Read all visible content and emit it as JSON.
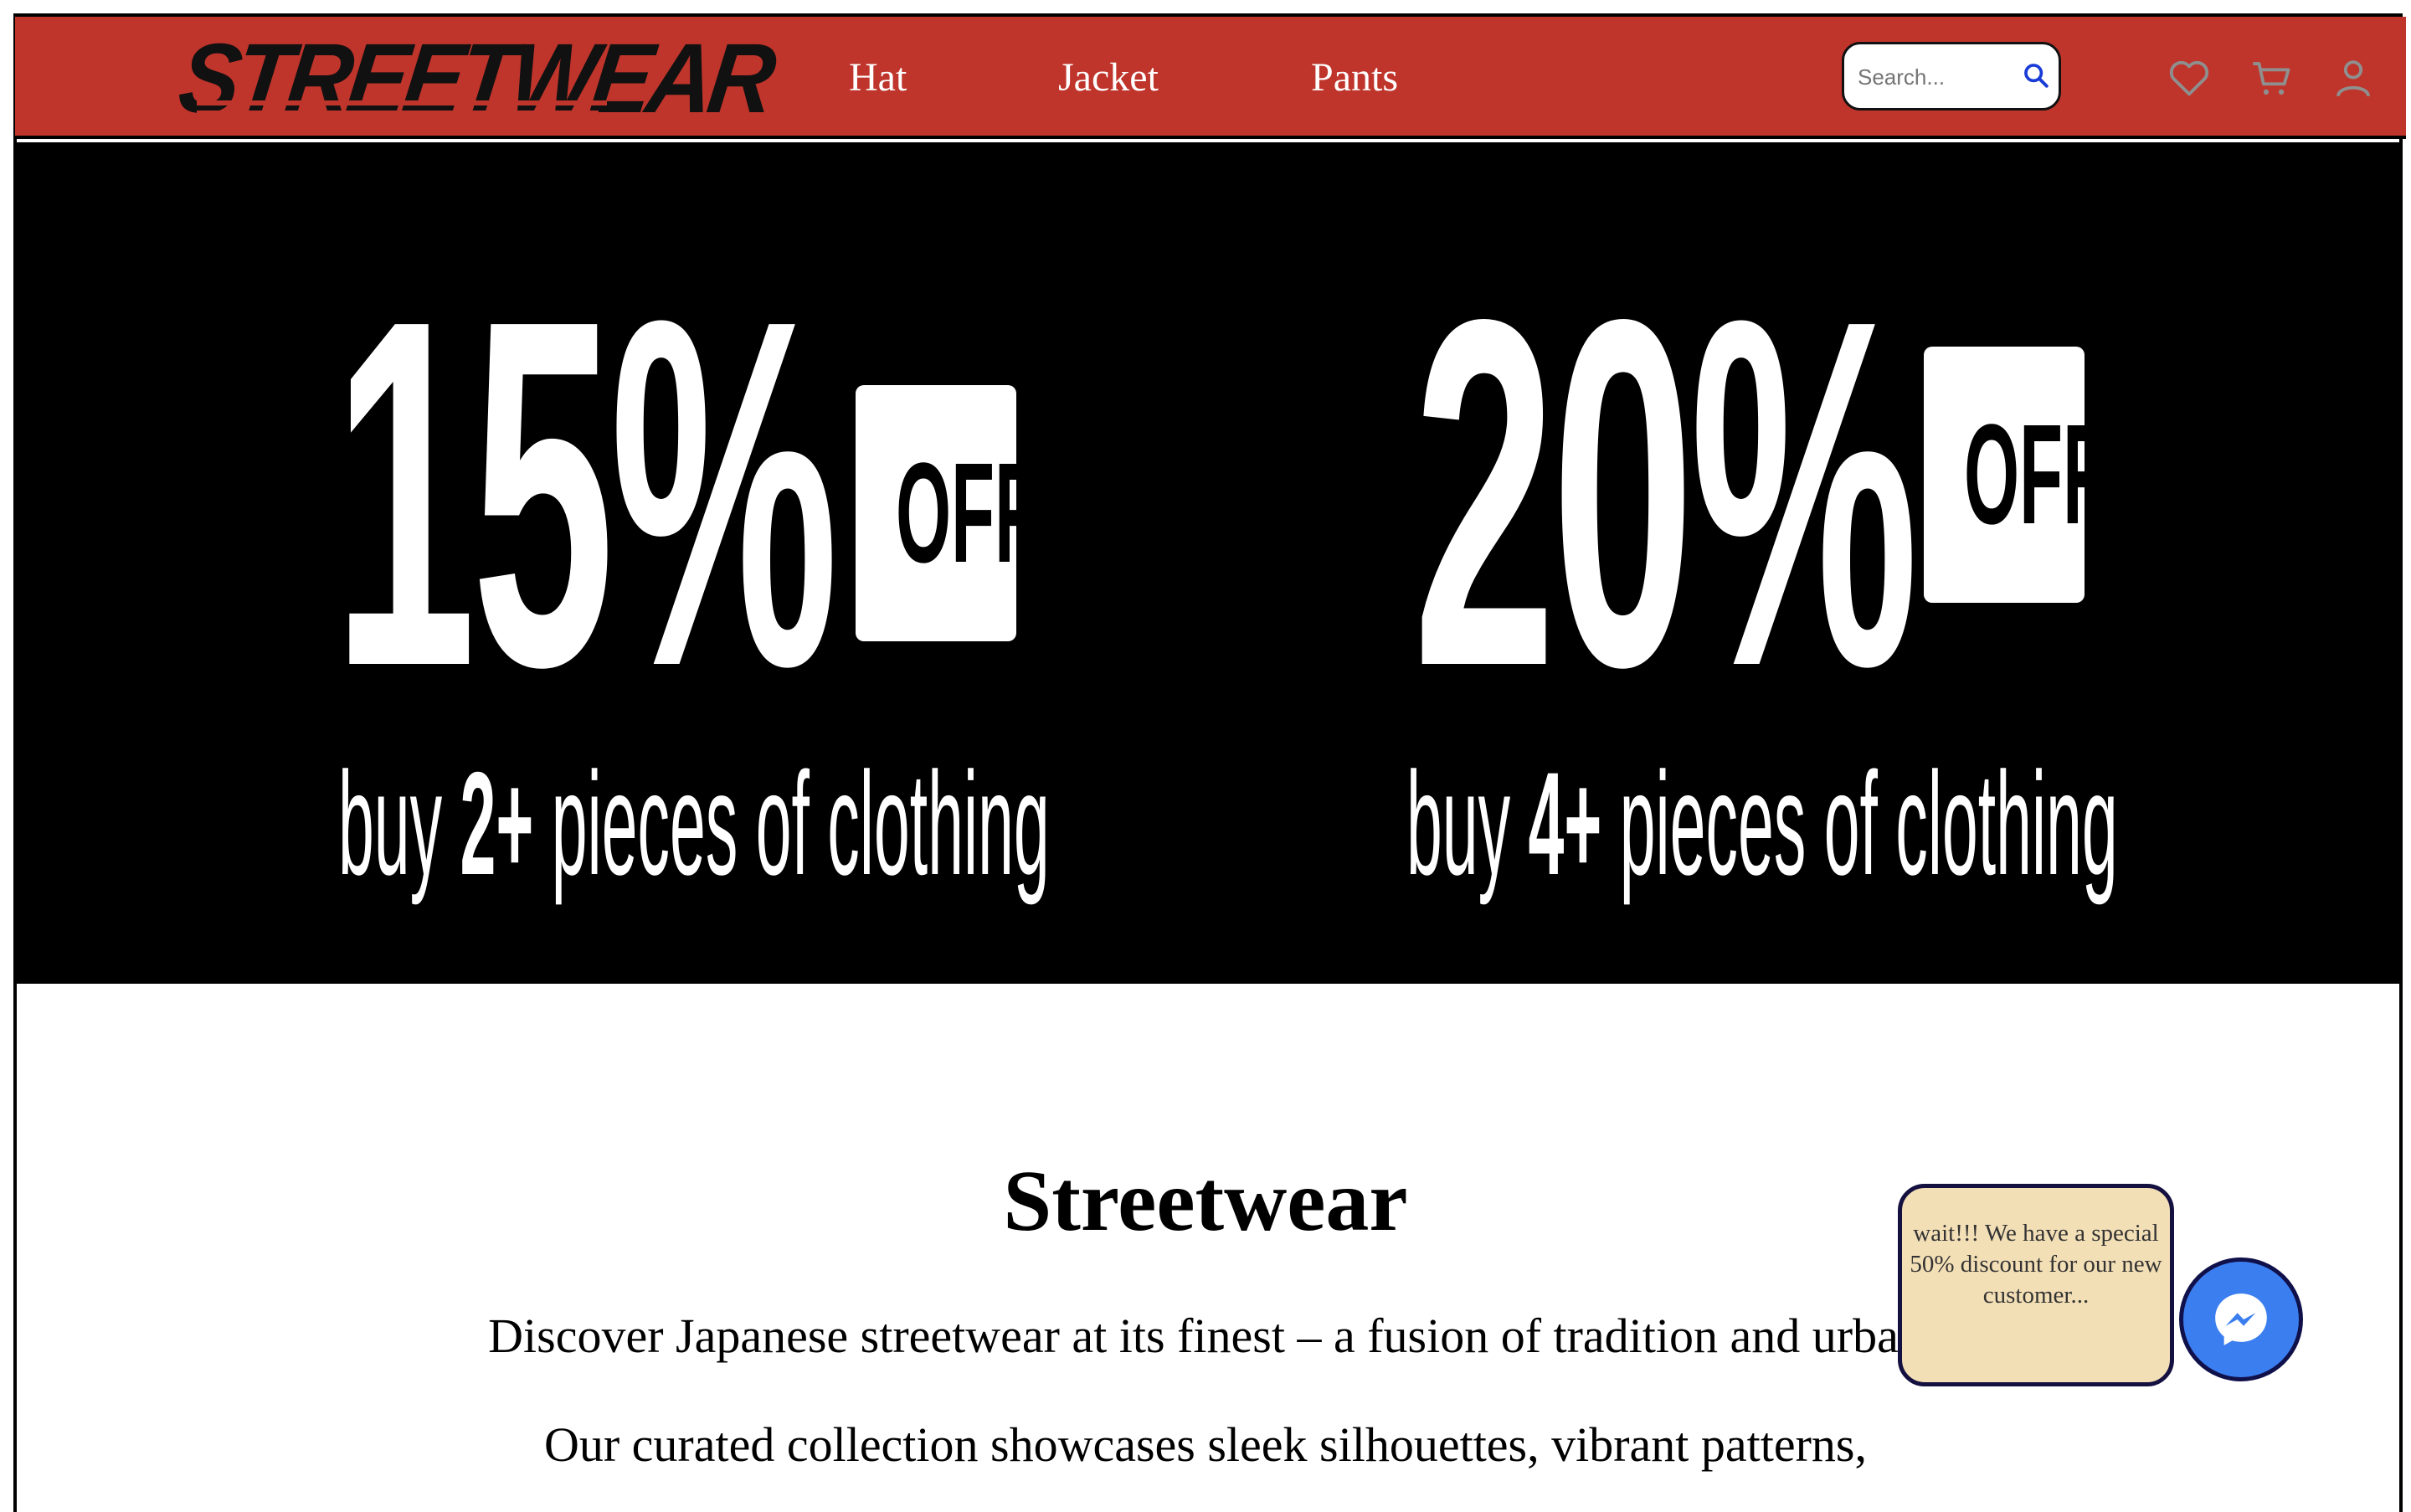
{
  "header": {
    "logo_text": "STREETWEAR",
    "nav": [
      {
        "label": "Hat"
      },
      {
        "label": "Jacket"
      },
      {
        "label": "Pants"
      }
    ],
    "search": {
      "placeholder": "Search..."
    },
    "icons": [
      "heart-icon",
      "cart-icon",
      "user-icon",
      "search-icon"
    ],
    "brand_color": "#bf342b"
  },
  "hero": {
    "offers": [
      {
        "percent": "15%",
        "off_label": "OFF",
        "line_prefix": "buy ",
        "line_qty": "2+",
        "line_suffix": " pieces of clothing"
      },
      {
        "percent": "20%",
        "off_label": "OFF",
        "line_prefix": "buy ",
        "line_qty": "4+",
        "line_suffix": " pieces of clothing"
      }
    ]
  },
  "content": {
    "title": "Streetwear",
    "paragraphs": [
      "Discover Japanese streetwear at its finest – a fusion of tradition and urban",
      "Our curated collection showcases sleek silhouettes, vibrant patterns,"
    ]
  },
  "popup": {
    "text": "wait!!! We have a special 50% discount for our new customer..."
  },
  "chat": {
    "icon": "messenger-icon",
    "color": "#3b7ef0"
  }
}
